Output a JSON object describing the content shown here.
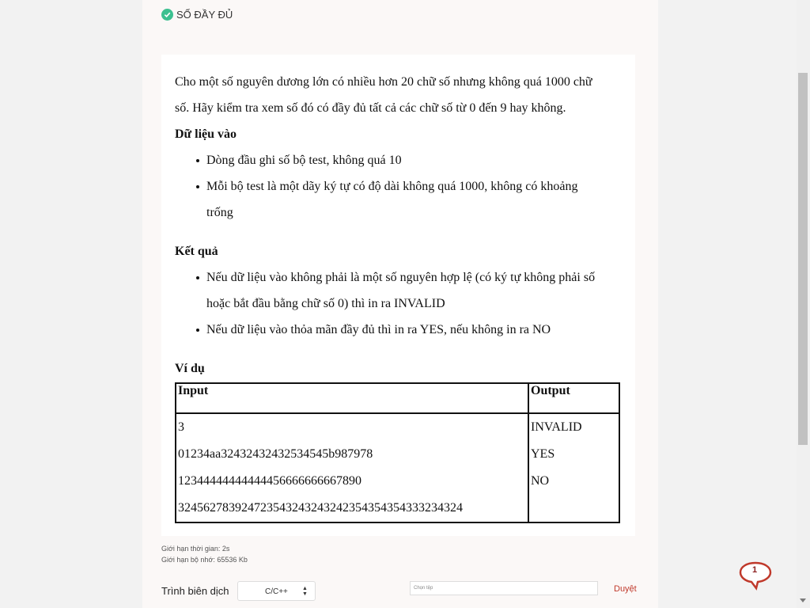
{
  "problem": {
    "title": "SỐ ĐẦY ĐỦ",
    "statement": [
      "Cho một số nguyên dương lớn có nhiều hơn 20 chữ số nhưng không quá 1000 chữ",
      "số. Hãy kiểm tra xem số đó có đầy đủ tất cả các chữ số từ 0 đến 9 hay không."
    ],
    "input_heading": "Dữ liệu vào",
    "input_items": [
      "Dòng đầu ghi số bộ test, không quá 10",
      "Mỗi bộ test là một dãy ký tự có độ dài không quá 1000, không có khoảng",
      "trống"
    ],
    "output_heading": "Kết quả",
    "output_items": [
      "Nếu dữ liệu vào không phải là một số nguyên hợp lệ (có ký tự không phải số",
      "hoặc bắt đầu bằng chữ số 0) thì in ra INVALID",
      "Nếu dữ liệu vào thỏa mãn đầy đủ thì in ra YES, nếu không in ra NO"
    ],
    "example_heading": "Ví dụ",
    "table": {
      "headers": [
        "Input",
        "Output"
      ],
      "input_lines": [
        "3",
        "01234aa32432432432534545b987978",
        "12344444444444456666666667890",
        "324562783924723543243243242354354354333234324"
      ],
      "output_lines": [
        "INVALID",
        "YES",
        "NO"
      ]
    }
  },
  "limits": {
    "time": "Giới hạn thời gian: 2s",
    "memory": "Giới hạn bộ nhớ: 65536 Kb"
  },
  "submit": {
    "compiler_label": "Trình biên dịch",
    "compiler_value": "C/C++",
    "file_placeholder": "Chọn tệp",
    "button_label": "Duyệt"
  },
  "chat": {
    "badge_count": "1"
  },
  "colors": {
    "check": "#3cc090",
    "submit_link": "#c0392b",
    "chat": "#c0392b"
  }
}
